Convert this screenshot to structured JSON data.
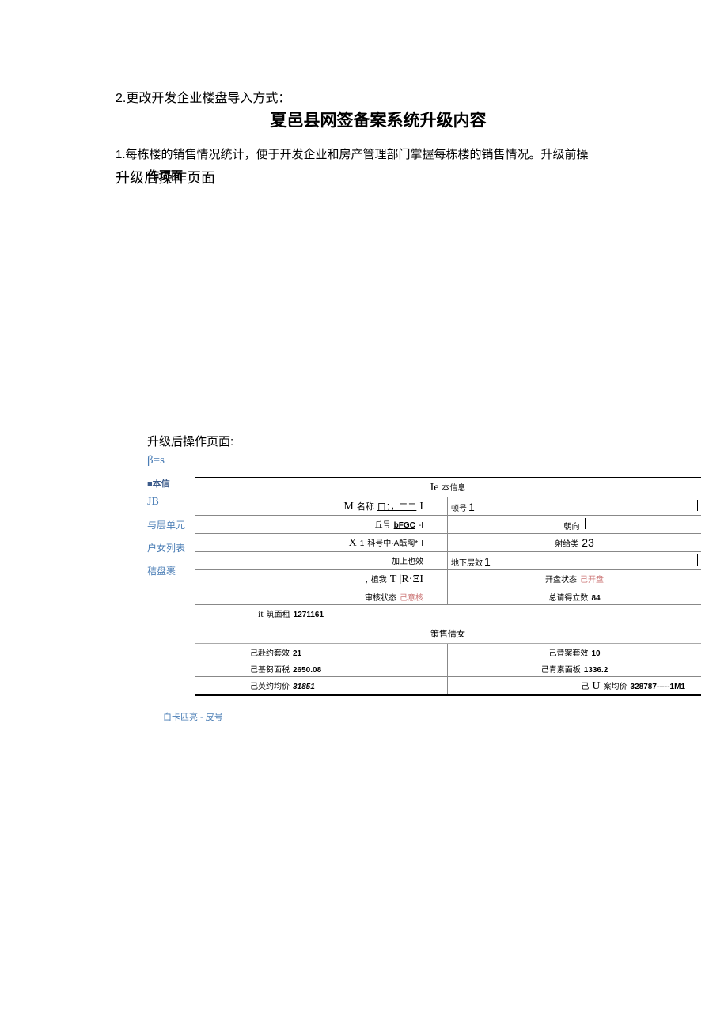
{
  "doc": {
    "line1": "2.更改开发企业楼盘导入方式：",
    "title": "夏邑县网签备案系统升级内容",
    "line3": "1.每栋楼的销售情况统计，便于开发企业和房产管理部门掌握每栋楼的销售情况。升级前操",
    "line4_base": "升级后操作页面",
    "line4_overlay": "作页面",
    "section2": "升级后操作页面:",
    "beta": "β=s",
    "sidebar": {
      "s1": "■本信",
      "s2": "JB",
      "s3": "与层单元",
      "s4": "户女列表",
      "s5": "秸盘裹"
    },
    "grid": {
      "header": "Ie",
      "header_suffix": "本信息",
      "sale_header": "策售倩女",
      "rows": [
        {
          "ll": "M",
          "lsuffix": "名称",
          "lul": "口：，二二",
          "ltrail": "I",
          "rl": "顿号",
          "rv": "1",
          "rbar": true
        },
        {
          "ll": "",
          "lsuffix": "丘号",
          "lul": "bFGC",
          "ltrail": "-I",
          "rl": "朝向",
          "rv": "",
          "rbar": true
        },
        {
          "ll": "X",
          "lsuffix": "1",
          "lsub": "科号中·A酝陶*",
          "ltrail": "I",
          "rl": "射给类",
          "rv": "23",
          "rbar": false
        },
        {
          "ll": "",
          "lsuffix": "加上也效",
          "rl": "地下层效",
          "rv": "1",
          "rbar": true
        },
        {
          "ll": ",",
          "lsuffix": "植我",
          "lserif": "T |R·ΞI",
          "rl": "开盘状态",
          "rv": "己开盘",
          "rred": true
        },
        {
          "ll": "",
          "lsuffix": "审核状态",
          "lred": "己意核",
          "rl": "总请得立数",
          "rv": "84"
        },
        {
          "ll": "it",
          "lsuffix": "筑面租",
          "lbold": "1271161",
          "rl": "",
          "rv": ""
        }
      ],
      "salerows": [
        {
          "ll": "己赴约套效",
          "lv": "21",
          "rl": "己昔案套效",
          "rv": "10"
        },
        {
          "ll": "己基芻面税",
          "lv": "2650.08",
          "rl": "己青素面板",
          "rv": "1336.2"
        },
        {
          "ll": "己英约均价",
          "lv": "31851",
          "rl": "己",
          "rmid": "U",
          "rsuffix": "案均价",
          "rv": "328787-----1M1"
        }
      ]
    },
    "footer": "白卡匹亮 - 皮号"
  }
}
